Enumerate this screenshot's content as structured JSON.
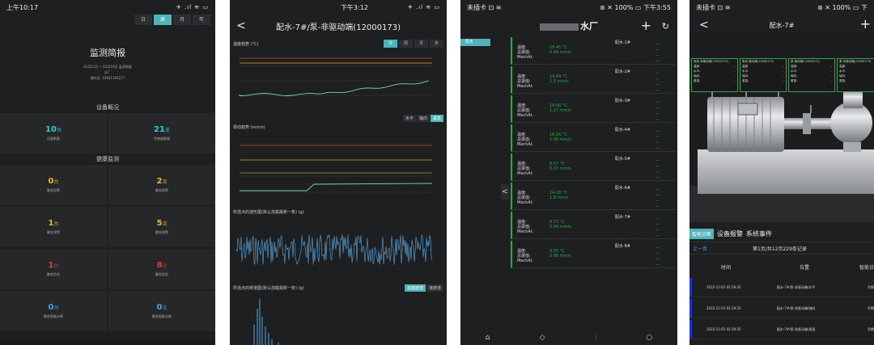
{
  "phone1": {
    "status": {
      "time": "上午10:17",
      "icons": "✈ .ıl ≋ ▭"
    },
    "range_tabs": [
      "日",
      "周",
      "月",
      "年"
    ],
    "active_range": 1,
    "title": "监测简报",
    "sub_lines": [
      "01月11日 ~ 01月18日 监测周报",
      "水厂",
      "操作员: 15921166217"
    ],
    "section_overview": "设备概况",
    "overview": [
      {
        "value": "10",
        "unit": "台",
        "label": "设备数量",
        "color": "#33c9d6"
      },
      {
        "value": "21",
        "unit": "支",
        "label": "传感器数量",
        "color": "#33c9d6"
      }
    ],
    "section_health": "健康监测",
    "health": [
      {
        "value": "0",
        "unit": "台",
        "label": "触发报警",
        "color": "#e8b53a"
      },
      {
        "value": "2",
        "unit": "次",
        "label": "触发报警",
        "color": "#e8b53a"
      },
      {
        "value": "1",
        "unit": "台",
        "label": "触发预警",
        "color": "#e8b53a"
      },
      {
        "value": "5",
        "unit": "次",
        "label": "触发预警",
        "color": "#e8b53a"
      },
      {
        "value": "1",
        "unit": "台",
        "label": "触发危险",
        "color": "#e23b3b"
      },
      {
        "value": "8",
        "unit": "次",
        "label": "触发危险",
        "color": "#e23b3b"
      },
      {
        "value": "0",
        "unit": "台",
        "label": "触发智能诊断",
        "color": "#4aa3df"
      },
      {
        "value": "0",
        "unit": "次",
        "label": "触发智能诊断",
        "color": "#4aa3df"
      }
    ]
  },
  "phone2": {
    "status": {
      "time": "下午3:12",
      "icons": "✈ .ıl ≋ ▭"
    },
    "back": "<",
    "title": "配水-7#/泵-非驱动端(12000173)",
    "temp_label": "温度趋势 (°C)",
    "range_tabs": [
      "日",
      "周",
      "月",
      "年"
    ],
    "active_range": 0,
    "vib_label": "振动趋势 (mm/s)",
    "axis_tabs": [
      "水平",
      "轴向",
      "垂直"
    ],
    "active_axis": 2,
    "wave_label": "所选点的波形图(默认加载最新一条) (g)",
    "env_label": "所选点的频谱图(默认加载最新一条) (g)",
    "env_tabs": [
      "加速度谱",
      "速度谱"
    ],
    "active_env": 0
  },
  "phone3": {
    "status": {
      "left": "未插卡 ⊡ ≋",
      "right": "⊛ ✕ 100% ▭ 下午3:55"
    },
    "title_suffix": "水厂",
    "side_tag": "配水",
    "collapse": "<",
    "field_labels": [
      "温度:",
      "总振值:",
      "MechAI:"
    ],
    "items": [
      {
        "name": "配水-1#",
        "temp": "19.45 °C",
        "vib": "0.99 mm/s"
      },
      {
        "name": "配水-2#",
        "temp": "19.94 °C",
        "vib": "1.3 mm/s"
      },
      {
        "name": "配水-3#",
        "temp": "19.40 °C",
        "vib": "1.27 mm/s"
      },
      {
        "name": "配水-4#",
        "temp": "18.16 °C",
        "vib": "1.06 mm/s"
      },
      {
        "name": "配水-5#",
        "temp": "8.57 °C",
        "vib": "0.07 mm/s"
      },
      {
        "name": "配水-6#",
        "temp": "24.18 °C",
        "vib": "1.8 mm/s"
      },
      {
        "name": "配水-7#",
        "temp": "9.73 °C",
        "vib": "0.06 mm/s"
      },
      {
        "name": "配水-8#",
        "temp": "9.05 °C",
        "vib": "0.06 mm/s"
      }
    ]
  },
  "phone4": {
    "status": {
      "left": "未插卡 ⊡ ≋",
      "right": "⊛ ✕ 100% ▭ 下"
    },
    "back": "<",
    "title": "配水-7#",
    "sensor_cards": [
      {
        "head": "电机-非驱动端(12000170)"
      },
      {
        "head": "电机-驱动端(12000171)"
      },
      {
        "head": "泵-驱动端(12000172)"
      },
      {
        "head": "泵-非驱动端(12000173)"
      }
    ],
    "card_rows": [
      "温度:",
      "水平:",
      "轴向:",
      "垂直:"
    ],
    "tabs": [
      "智能诊断",
      "设备报警",
      "系统事件"
    ],
    "active_tab": 0,
    "pager_prev": "上一页",
    "pager_info": "第1页/共12页229条记录",
    "columns": [
      "时间",
      "位置",
      "智能诊"
    ],
    "rows": [
      {
        "time": "2022-12-01 02:19:35",
        "pos": "配水-7#/泵-非驱动端/水平",
        "diag": "早期"
      },
      {
        "time": "2022-12-01 02:19:35",
        "pos": "配水-7#/泵-非驱动端/轴向",
        "diag": "早期"
      },
      {
        "time": "2022-12-01 02:19:35",
        "pos": "配水-7#/泵-非驱动端/垂直",
        "diag": "早期"
      }
    ]
  },
  "colors": {
    "accent": "#4fb3b9",
    "ok": "#2aa84a",
    "line": "#7fd99a"
  }
}
